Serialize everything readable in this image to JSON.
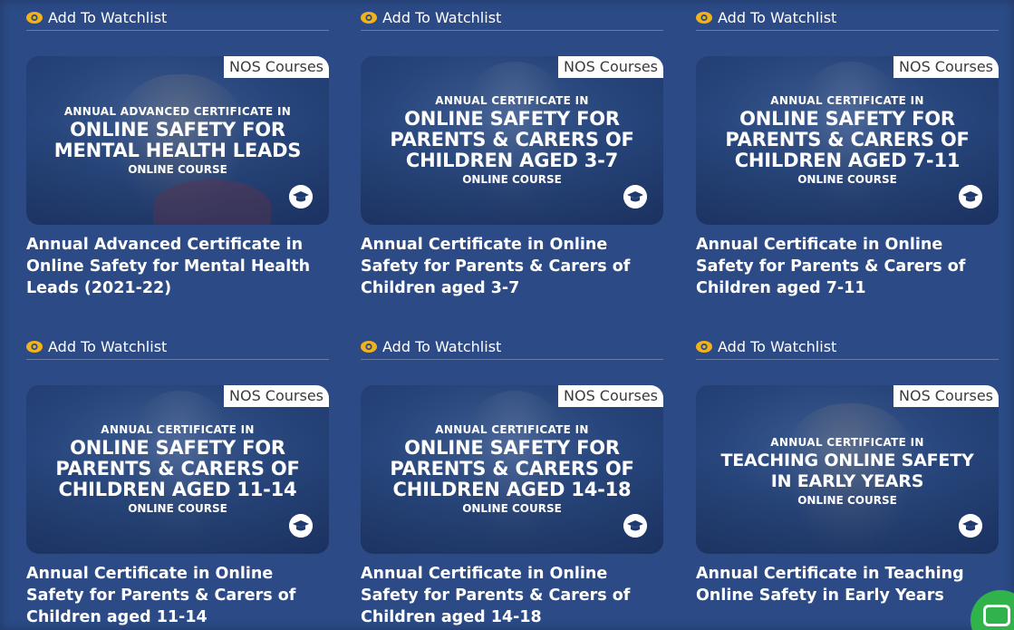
{
  "watchlist_label": "Add To Watchlist",
  "badge_label": "NOS Courses",
  "colors": {
    "background": "#2b4a86",
    "eye_icon": "#f2b21b",
    "chat_button": "#2fb34a"
  },
  "icons": {
    "watchlist": "eye-icon",
    "course": "graduation-cap-icon",
    "chat": "chat-icon"
  },
  "courses": [
    {
      "overlay_top": "ANNUAL ADVANCED CERTIFICATE IN",
      "overlay_main": "ONLINE SAFETY FOR\nMENTAL HEALTH LEADS",
      "overlay_bottom": "ONLINE COURSE",
      "title": "Annual Advanced Certificate in Online Safety for Mental Health Leads (2021-22)"
    },
    {
      "overlay_top": "ANNUAL CERTIFICATE IN",
      "overlay_main": "ONLINE SAFETY FOR\nPARENTS & CARERS OF\nCHILDREN AGED 3-7",
      "overlay_bottom": "ONLINE COURSE",
      "title": "Annual Certificate in Online Safety for Parents & Carers of Children aged 3-7"
    },
    {
      "overlay_top": "ANNUAL CERTIFICATE IN",
      "overlay_main": "ONLINE SAFETY FOR\nPARENTS & CARERS OF\nCHILDREN AGED 7-11",
      "overlay_bottom": "ONLINE COURSE",
      "title": "Annual Certificate in Online Safety for Parents & Carers of Children aged 7-11"
    },
    {
      "overlay_top": "ANNUAL CERTIFICATE IN",
      "overlay_main": "ONLINE SAFETY FOR\nPARENTS & CARERS OF\nCHILDREN AGED 11-14",
      "overlay_bottom": "ONLINE COURSE",
      "title": "Annual Certificate in Online Safety for Parents & Carers of Children aged 11-14"
    },
    {
      "overlay_top": "ANNUAL CERTIFICATE IN",
      "overlay_main": "ONLINE SAFETY FOR\nPARENTS & CARERS OF\nCHILDREN AGED 14-18",
      "overlay_bottom": "ONLINE COURSE",
      "title": "Annual Certificate in Online Safety for Parents & Carers of Children aged 14-18"
    },
    {
      "overlay_top": "ANNUAL CERTIFICATE IN",
      "overlay_main": "TEACHING ONLINE SAFETY\nIN EARLY YEARS",
      "overlay_bottom": "ONLINE COURSE",
      "title": "Annual Certificate in Teaching Online Safety in Early Years"
    }
  ]
}
